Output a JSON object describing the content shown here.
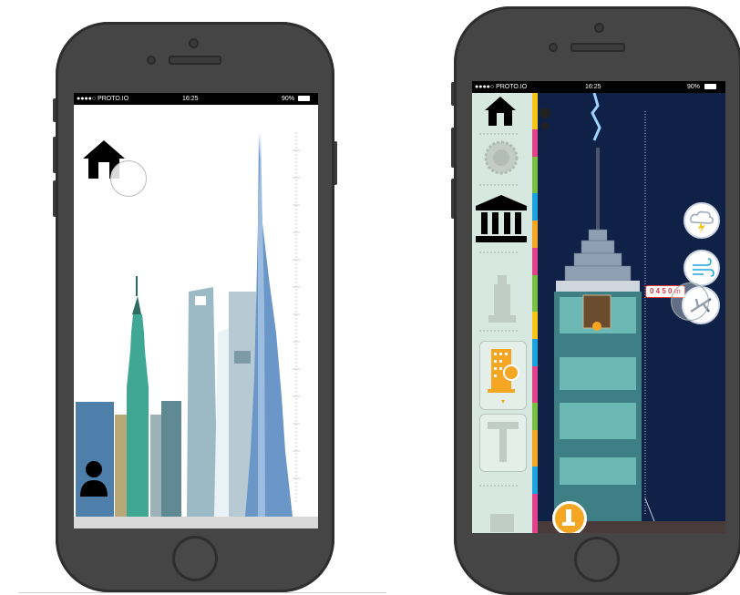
{
  "left_phone": {
    "status": {
      "carrier": "●●●●○ PROTO.IO",
      "time": "16:25",
      "battery": "90%"
    },
    "icons": [
      "home-icon",
      "person-icon"
    ]
  },
  "right_phone": {
    "status": {
      "carrier": "●●●●○ PROTO.IO",
      "time": "16:25",
      "battery": "90%"
    },
    "height_label": "0 4 5 0 m",
    "sidebar_icons": [
      "home-icon",
      "gear-icon",
      "museum-icon",
      "tower-icon",
      "building-icon",
      "t-beam-icon"
    ],
    "side_buttons": [
      "storm-icon",
      "wind-icon",
      "plane-icon"
    ],
    "colors": {
      "sky": "#0f2146",
      "sidebar": "#d7e8e0",
      "accent": "#f5a623"
    }
  }
}
